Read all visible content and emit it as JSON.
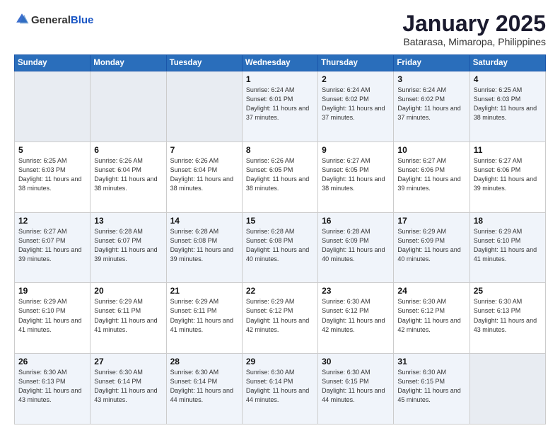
{
  "header": {
    "logo_general": "General",
    "logo_blue": "Blue",
    "title": "January 2025",
    "location": "Batarasa, Mimaropa, Philippines"
  },
  "weekdays": [
    "Sunday",
    "Monday",
    "Tuesday",
    "Wednesday",
    "Thursday",
    "Friday",
    "Saturday"
  ],
  "weeks": [
    [
      {
        "day": "",
        "sunrise": "",
        "sunset": "",
        "daylight": "",
        "empty": true
      },
      {
        "day": "",
        "sunrise": "",
        "sunset": "",
        "daylight": "",
        "empty": true
      },
      {
        "day": "",
        "sunrise": "",
        "sunset": "",
        "daylight": "",
        "empty": true
      },
      {
        "day": "1",
        "sunrise": "Sunrise: 6:24 AM",
        "sunset": "Sunset: 6:01 PM",
        "daylight": "Daylight: 11 hours and 37 minutes."
      },
      {
        "day": "2",
        "sunrise": "Sunrise: 6:24 AM",
        "sunset": "Sunset: 6:02 PM",
        "daylight": "Daylight: 11 hours and 37 minutes."
      },
      {
        "day": "3",
        "sunrise": "Sunrise: 6:24 AM",
        "sunset": "Sunset: 6:02 PM",
        "daylight": "Daylight: 11 hours and 37 minutes."
      },
      {
        "day": "4",
        "sunrise": "Sunrise: 6:25 AM",
        "sunset": "Sunset: 6:03 PM",
        "daylight": "Daylight: 11 hours and 38 minutes."
      }
    ],
    [
      {
        "day": "5",
        "sunrise": "Sunrise: 6:25 AM",
        "sunset": "Sunset: 6:03 PM",
        "daylight": "Daylight: 11 hours and 38 minutes."
      },
      {
        "day": "6",
        "sunrise": "Sunrise: 6:26 AM",
        "sunset": "Sunset: 6:04 PM",
        "daylight": "Daylight: 11 hours and 38 minutes."
      },
      {
        "day": "7",
        "sunrise": "Sunrise: 6:26 AM",
        "sunset": "Sunset: 6:04 PM",
        "daylight": "Daylight: 11 hours and 38 minutes."
      },
      {
        "day": "8",
        "sunrise": "Sunrise: 6:26 AM",
        "sunset": "Sunset: 6:05 PM",
        "daylight": "Daylight: 11 hours and 38 minutes."
      },
      {
        "day": "9",
        "sunrise": "Sunrise: 6:27 AM",
        "sunset": "Sunset: 6:05 PM",
        "daylight": "Daylight: 11 hours and 38 minutes."
      },
      {
        "day": "10",
        "sunrise": "Sunrise: 6:27 AM",
        "sunset": "Sunset: 6:06 PM",
        "daylight": "Daylight: 11 hours and 39 minutes."
      },
      {
        "day": "11",
        "sunrise": "Sunrise: 6:27 AM",
        "sunset": "Sunset: 6:06 PM",
        "daylight": "Daylight: 11 hours and 39 minutes."
      }
    ],
    [
      {
        "day": "12",
        "sunrise": "Sunrise: 6:27 AM",
        "sunset": "Sunset: 6:07 PM",
        "daylight": "Daylight: 11 hours and 39 minutes."
      },
      {
        "day": "13",
        "sunrise": "Sunrise: 6:28 AM",
        "sunset": "Sunset: 6:07 PM",
        "daylight": "Daylight: 11 hours and 39 minutes."
      },
      {
        "day": "14",
        "sunrise": "Sunrise: 6:28 AM",
        "sunset": "Sunset: 6:08 PM",
        "daylight": "Daylight: 11 hours and 39 minutes."
      },
      {
        "day": "15",
        "sunrise": "Sunrise: 6:28 AM",
        "sunset": "Sunset: 6:08 PM",
        "daylight": "Daylight: 11 hours and 40 minutes."
      },
      {
        "day": "16",
        "sunrise": "Sunrise: 6:28 AM",
        "sunset": "Sunset: 6:09 PM",
        "daylight": "Daylight: 11 hours and 40 minutes."
      },
      {
        "day": "17",
        "sunrise": "Sunrise: 6:29 AM",
        "sunset": "Sunset: 6:09 PM",
        "daylight": "Daylight: 11 hours and 40 minutes."
      },
      {
        "day": "18",
        "sunrise": "Sunrise: 6:29 AM",
        "sunset": "Sunset: 6:10 PM",
        "daylight": "Daylight: 11 hours and 41 minutes."
      }
    ],
    [
      {
        "day": "19",
        "sunrise": "Sunrise: 6:29 AM",
        "sunset": "Sunset: 6:10 PM",
        "daylight": "Daylight: 11 hours and 41 minutes."
      },
      {
        "day": "20",
        "sunrise": "Sunrise: 6:29 AM",
        "sunset": "Sunset: 6:11 PM",
        "daylight": "Daylight: 11 hours and 41 minutes."
      },
      {
        "day": "21",
        "sunrise": "Sunrise: 6:29 AM",
        "sunset": "Sunset: 6:11 PM",
        "daylight": "Daylight: 11 hours and 41 minutes."
      },
      {
        "day": "22",
        "sunrise": "Sunrise: 6:29 AM",
        "sunset": "Sunset: 6:12 PM",
        "daylight": "Daylight: 11 hours and 42 minutes."
      },
      {
        "day": "23",
        "sunrise": "Sunrise: 6:30 AM",
        "sunset": "Sunset: 6:12 PM",
        "daylight": "Daylight: 11 hours and 42 minutes."
      },
      {
        "day": "24",
        "sunrise": "Sunrise: 6:30 AM",
        "sunset": "Sunset: 6:12 PM",
        "daylight": "Daylight: 11 hours and 42 minutes."
      },
      {
        "day": "25",
        "sunrise": "Sunrise: 6:30 AM",
        "sunset": "Sunset: 6:13 PM",
        "daylight": "Daylight: 11 hours and 43 minutes."
      }
    ],
    [
      {
        "day": "26",
        "sunrise": "Sunrise: 6:30 AM",
        "sunset": "Sunset: 6:13 PM",
        "daylight": "Daylight: 11 hours and 43 minutes."
      },
      {
        "day": "27",
        "sunrise": "Sunrise: 6:30 AM",
        "sunset": "Sunset: 6:14 PM",
        "daylight": "Daylight: 11 hours and 43 minutes."
      },
      {
        "day": "28",
        "sunrise": "Sunrise: 6:30 AM",
        "sunset": "Sunset: 6:14 PM",
        "daylight": "Daylight: 11 hours and 44 minutes."
      },
      {
        "day": "29",
        "sunrise": "Sunrise: 6:30 AM",
        "sunset": "Sunset: 6:14 PM",
        "daylight": "Daylight: 11 hours and 44 minutes."
      },
      {
        "day": "30",
        "sunrise": "Sunrise: 6:30 AM",
        "sunset": "Sunset: 6:15 PM",
        "daylight": "Daylight: 11 hours and 44 minutes."
      },
      {
        "day": "31",
        "sunrise": "Sunrise: 6:30 AM",
        "sunset": "Sunset: 6:15 PM",
        "daylight": "Daylight: 11 hours and 45 minutes."
      },
      {
        "day": "",
        "sunrise": "",
        "sunset": "",
        "daylight": "",
        "empty": true
      }
    ]
  ]
}
